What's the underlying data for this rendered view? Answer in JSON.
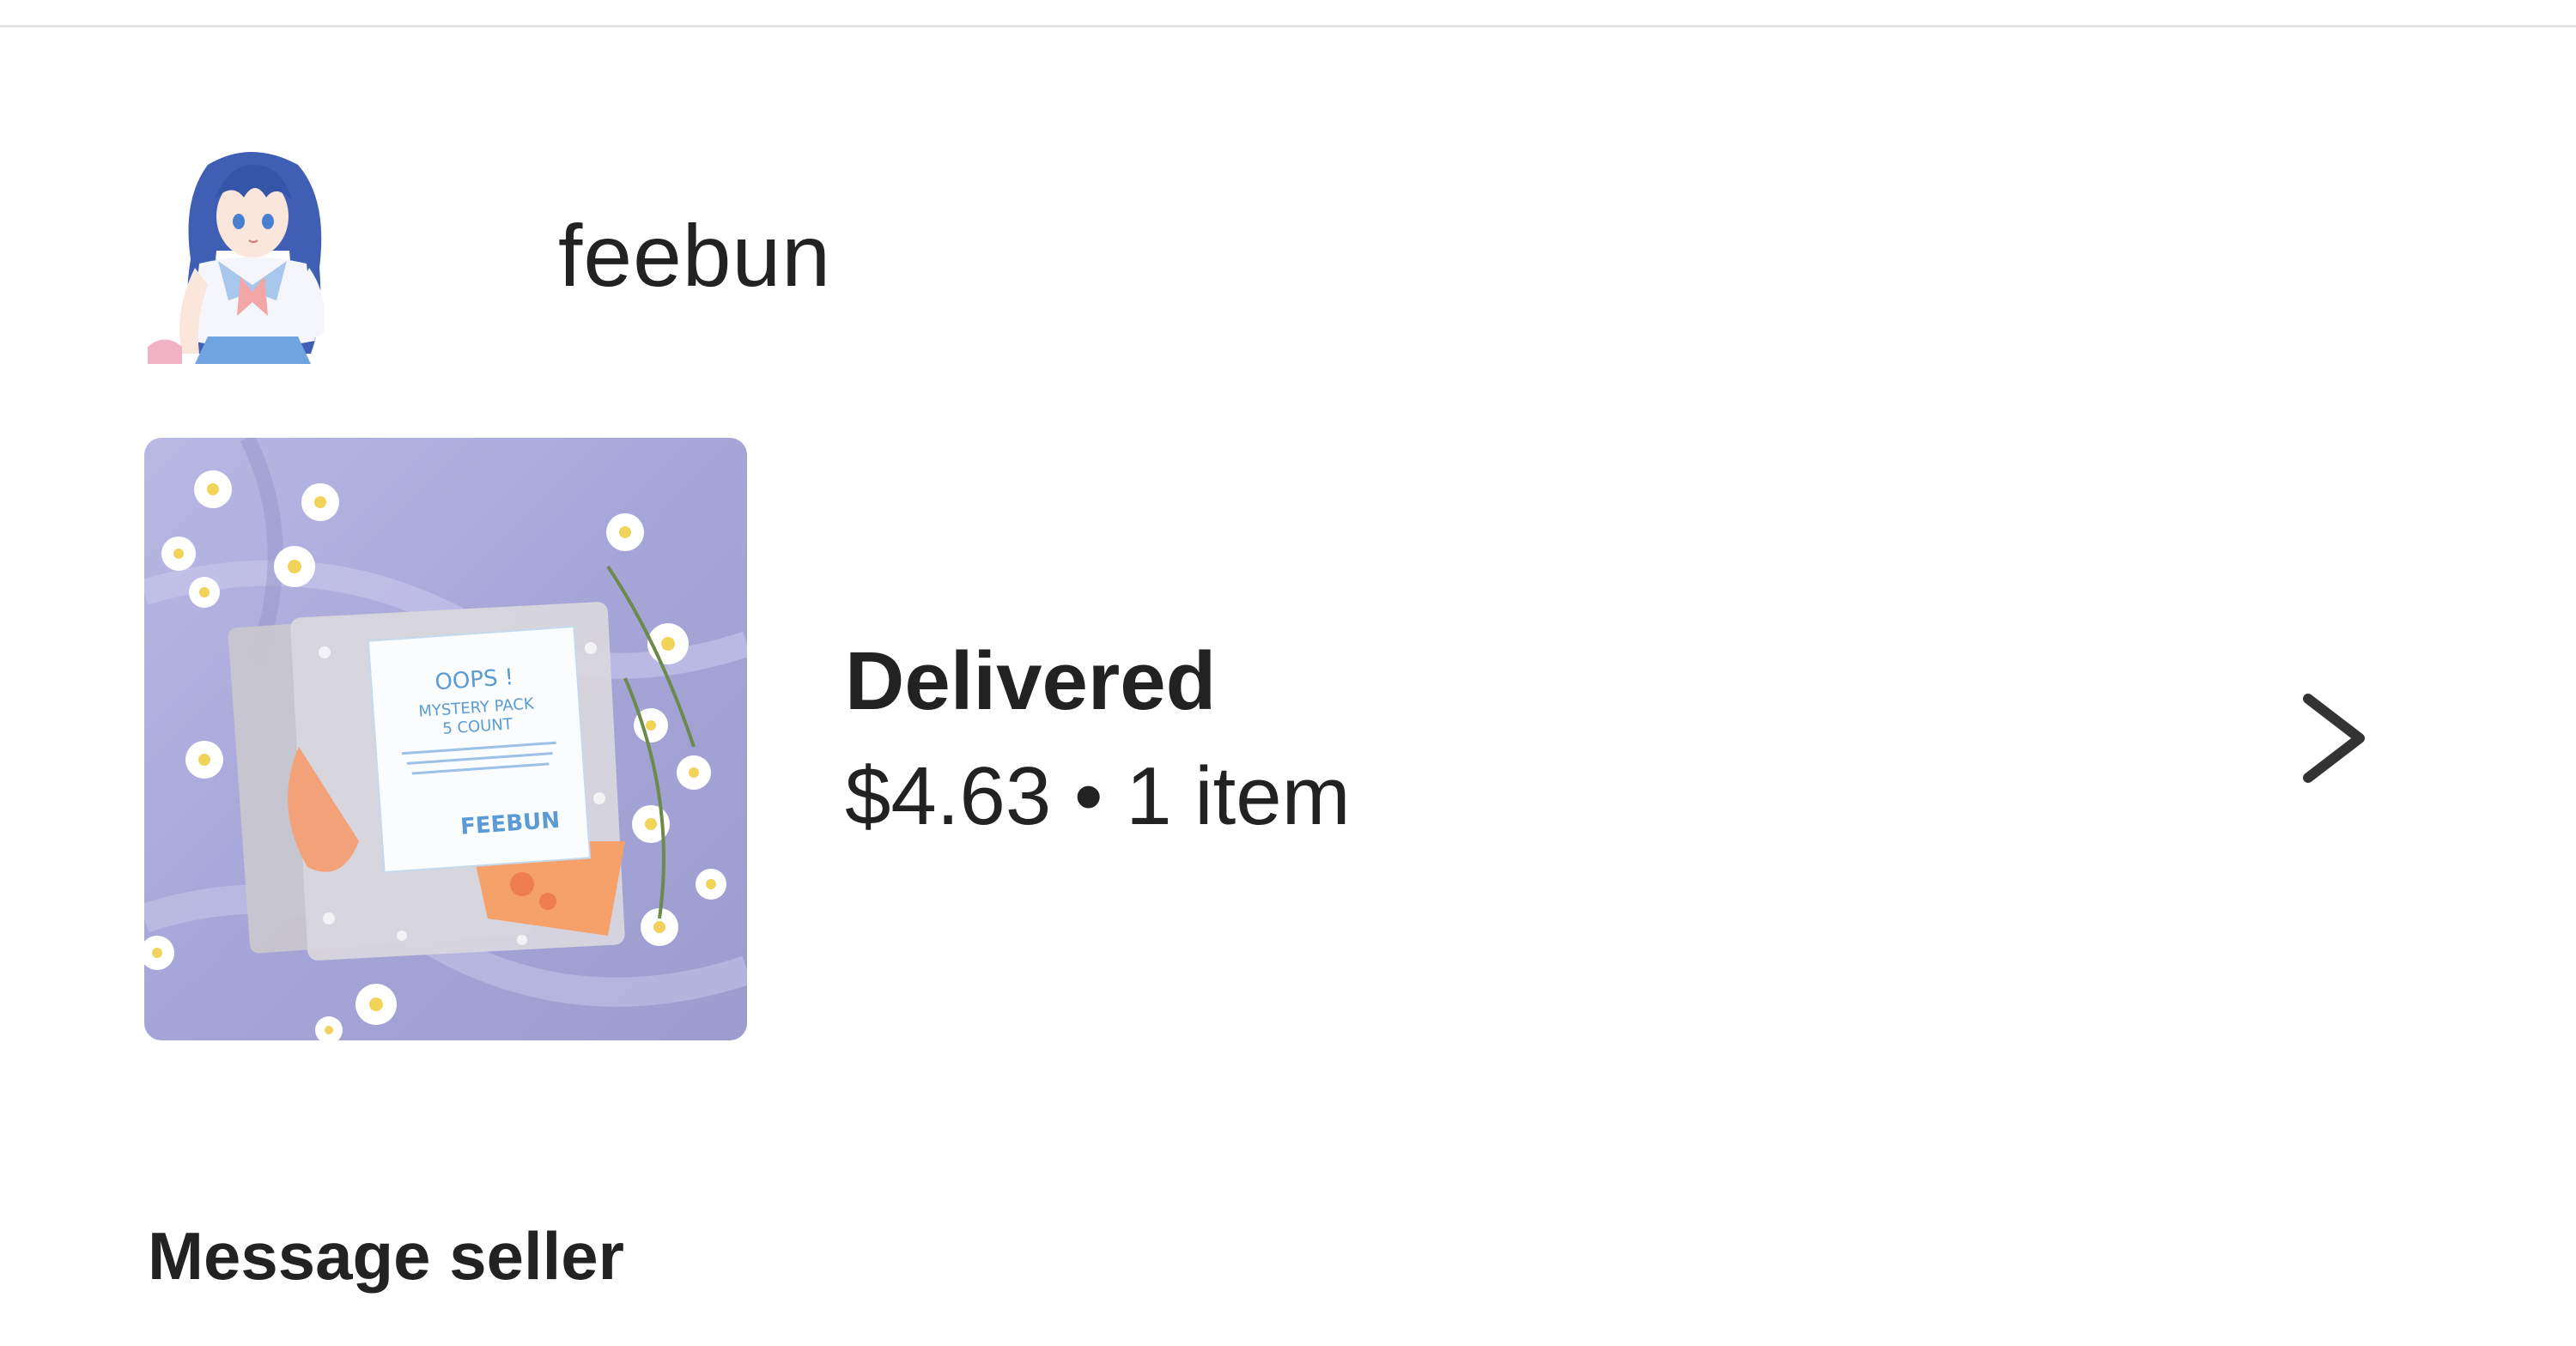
{
  "shop": {
    "name": "feebun",
    "avatar_icon": "anime-girl-avatar"
  },
  "order": {
    "status": "Delivered",
    "price": "$4.63",
    "separator": "•",
    "item_count": "1 item",
    "thumbnail": {
      "description_icon": "sticker-pack-photo",
      "card_title": "OOPS !",
      "card_line1": "MYSTERY PACK",
      "card_line2": "5 COUNT",
      "card_brand": "FEEBUN"
    },
    "chevron_icon": "chevron-right-icon"
  },
  "actions": {
    "message_seller": "Message seller"
  },
  "colors": {
    "text": "#222222",
    "divider": "#e5e5e5",
    "background": "#ffffff",
    "thumb_bg": "#a9a9d6"
  }
}
